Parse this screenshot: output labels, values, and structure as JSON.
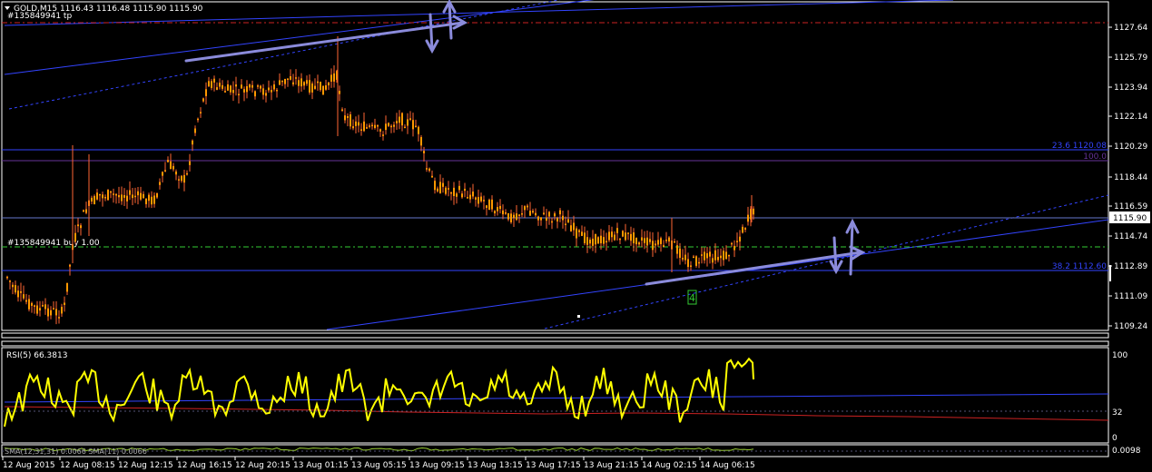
{
  "header": {
    "symbol_line": "GOLD,M15  1116.43 1116.48 1115.90 1115.90",
    "order_tp_label": "#135849941 tp",
    "order_buy_label": "#135849941 buy 1.00"
  },
  "fib_labels": {
    "fib_236": "23.6 1120.08",
    "fib_100": "100.0",
    "fib_382": "38.2 1112.60"
  },
  "wave_label": "4",
  "price_axis": {
    "ticks": [
      "1127.64",
      "1125.79",
      "1123.94",
      "1122.14",
      "1120.29",
      "1118.44",
      "1116.59",
      "1114.74",
      "1112.89",
      "1111.09",
      "1109.24"
    ],
    "current_price": "1115.90"
  },
  "rsi_panel": {
    "label": "RSI(5) 66.3813",
    "ticks": [
      "100",
      "32",
      "0"
    ]
  },
  "sma_panel": {
    "label": "SMA(12,31,31) 0.0066 SMA(11) 0.0066",
    "ticks": [
      "0.0098"
    ]
  },
  "time_axis": {
    "labels": [
      "12 Aug 2015",
      "12 Aug 08:15",
      "12 Aug 12:15",
      "12 Aug 16:15",
      "12 Aug 20:15",
      "13 Aug 01:15",
      "13 Aug 05:15",
      "13 Aug 09:15",
      "13 Aug 13:15",
      "13 Aug 17:15",
      "13 Aug 21:15",
      "14 Aug 02:15",
      "14 Aug 06:15"
    ]
  },
  "colors": {
    "background": "#000000",
    "candle": "#ff9900",
    "candle_wick": "#ff6633",
    "trendline": "#3344ff",
    "arrow": "#8b8bdb",
    "tp_line": "#cc2222",
    "buy_line": "#33cc33",
    "fib_line": "#3344ff",
    "fib_100_line": "#663399",
    "rsi_line": "#ffff00",
    "rsi_signal": "#cc2222",
    "sma_line": "#99cc33",
    "axis_text": "#ffffff"
  }
}
